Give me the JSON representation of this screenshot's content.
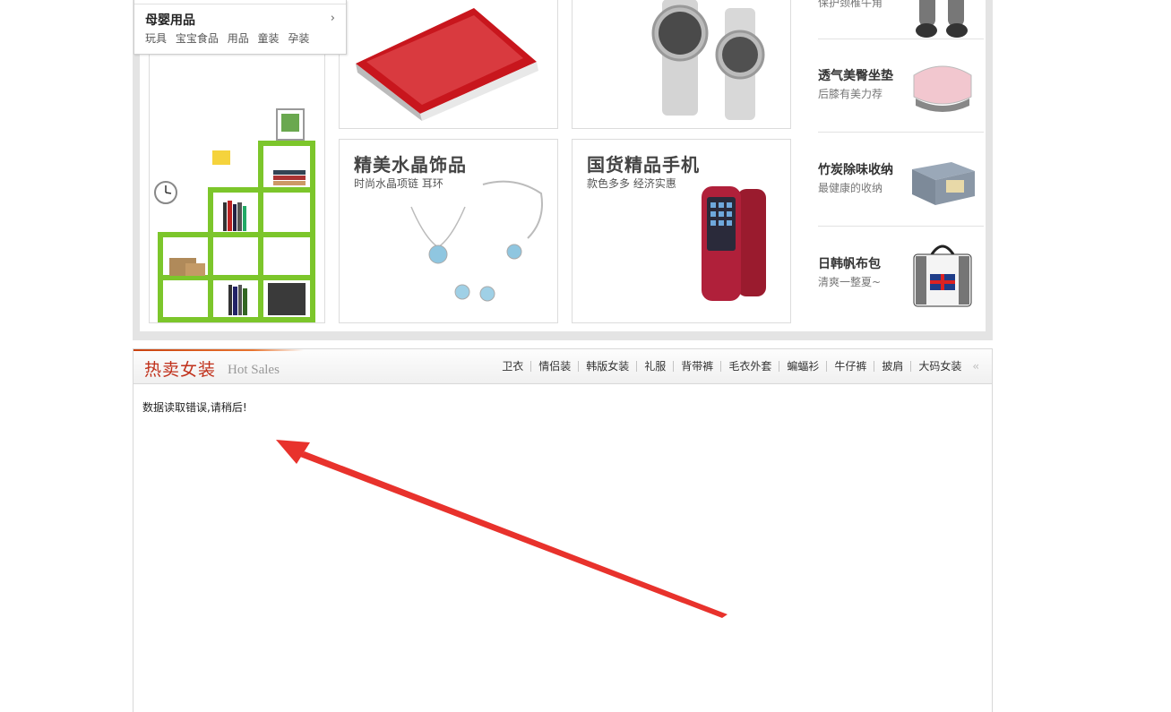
{
  "category_popup": {
    "title": "母婴用品",
    "links": [
      "玩具",
      "宝宝食品",
      "用品",
      "童装",
      "孕装"
    ]
  },
  "promo_tiles": {
    "crystal": {
      "title": "精美水晶饰品",
      "subtitle": "时尚水晶项链 耳环"
    },
    "phone": {
      "title": "国货精品手机",
      "subtitle": "款色多多 经济实惠"
    }
  },
  "side_promos": [
    {
      "title": "透气美臀坐垫",
      "subtitle": "后膝有美力荐"
    },
    {
      "title": "竹炭除味收纳",
      "subtitle": "最健康的收纳"
    },
    {
      "title": "日韩帆布包",
      "subtitle": "清爽一整夏~"
    }
  ],
  "side_top_partial": "保护颈椎牛角",
  "hot_sales": {
    "title": "热卖女装",
    "subtitle": "Hot Sales",
    "tabs": [
      "卫衣",
      "情侣装",
      "韩版女装",
      "礼服",
      "背带裤",
      "毛衣外套",
      "蝙蝠衫",
      "牛仔裤",
      "披肩",
      "大码女装"
    ],
    "prev_icon": "double-chevron-left-icon",
    "message": "数据读取错误,请稍后!"
  },
  "colors": {
    "accent": "#c0301a",
    "annotation_arrow": "#e8322c"
  }
}
